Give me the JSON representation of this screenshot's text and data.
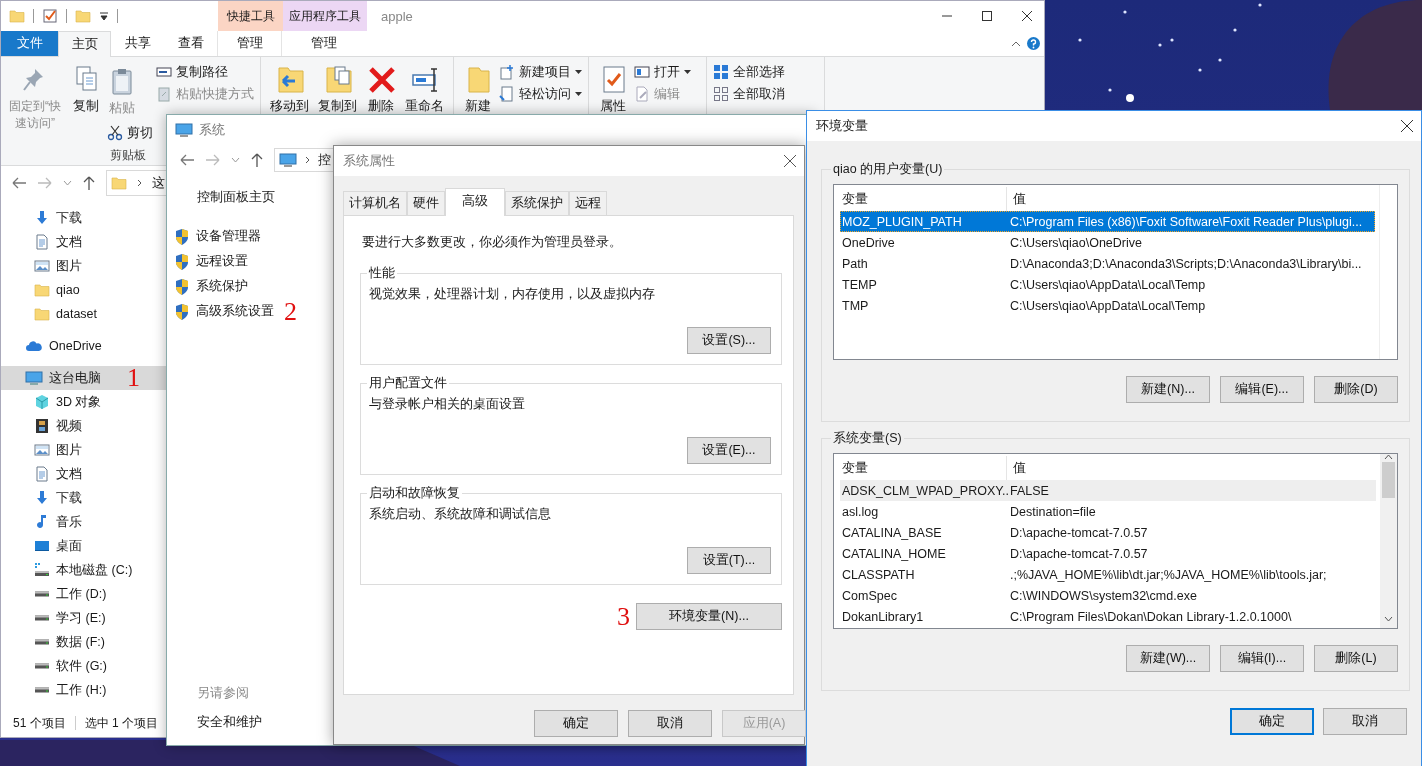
{
  "explorer": {
    "title": "apple",
    "context_tabs": [
      {
        "label": "快捷工具",
        "color": "#fbd5c4"
      },
      {
        "label": "应用程序工具",
        "color": "#ecd7f4"
      }
    ],
    "ribbon_tabs": [
      {
        "label": "文件",
        "kind": "file",
        "selected": false
      },
      {
        "label": "主页",
        "kind": "normal",
        "selected": true
      },
      {
        "label": "共享",
        "kind": "normal",
        "selected": false
      },
      {
        "label": "查看",
        "kind": "normal",
        "selected": false
      },
      {
        "label": "管理",
        "kind": "context",
        "selected": false
      },
      {
        "label": "管理",
        "kind": "context",
        "selected": false
      }
    ],
    "ribbon_groups": [
      {
        "label": "剪贴板",
        "items": [
          {
            "kind": "large",
            "label": "固定到“快速访问”",
            "disabled": true
          },
          {
            "kind": "large",
            "label": "复制",
            "disabled": false
          },
          {
            "kind": "stack",
            "items": [
              {
                "kind": "large",
                "label": "粘贴",
                "disabled": true,
                "dropdown": false
              },
              {
                "kind": "small",
                "label": "剪切",
                "disabled": false,
                "dropdown": false
              }
            ]
          },
          {
            "kind": "stack",
            "items": [
              {
                "kind": "small",
                "label": "复制路径",
                "disabled": false,
                "dropdown": false
              },
              {
                "kind": "small",
                "label": "粘贴快捷方式",
                "disabled": true,
                "dropdown": false
              }
            ]
          }
        ]
      },
      {
        "items": [
          {
            "kind": "large",
            "label": "移动到",
            "disabled": false
          },
          {
            "kind": "large",
            "label": "复制到",
            "disabled": false
          },
          {
            "kind": "large",
            "label": "删除",
            "disabled": false
          },
          {
            "kind": "large",
            "label": "重命名",
            "disabled": false
          }
        ]
      },
      {
        "items": [
          {
            "kind": "large",
            "label": "新建",
            "disabled": false
          },
          {
            "kind": "stack",
            "items": [
              {
                "kind": "small",
                "label": "新建项目",
                "disabled": false,
                "dropdown": true
              },
              {
                "kind": "small",
                "label": "轻松访问",
                "disabled": false,
                "dropdown": true
              }
            ]
          }
        ]
      },
      {
        "items": [
          {
            "kind": "large",
            "label": "属性",
            "disabled": false
          },
          {
            "kind": "stack",
            "items": [
              {
                "kind": "small",
                "label": "打开",
                "disabled": false,
                "dropdown": true
              },
              {
                "kind": "small",
                "label": "编辑",
                "disabled": true,
                "dropdown": false
              }
            ]
          }
        ]
      },
      {
        "items": [
          {
            "kind": "stack",
            "items": [
              {
                "kind": "small",
                "label": "全部选择",
                "disabled": false,
                "dropdown": false
              },
              {
                "kind": "small",
                "label": "全部取消",
                "disabled": false,
                "dropdown": false
              }
            ]
          }
        ]
      }
    ],
    "address": "这",
    "quick_access": [
      {
        "label": "下载",
        "kind": "download",
        "selected": false
      },
      {
        "label": "文档",
        "kind": "document",
        "selected": false
      },
      {
        "label": "图片",
        "kind": "picture",
        "selected": false
      },
      {
        "label": "qiao",
        "kind": "folder",
        "selected": false
      },
      {
        "label": "dataset",
        "kind": "folder",
        "selected": false
      }
    ],
    "nav": [
      {
        "label": "OneDrive",
        "kind": "cloud",
        "selected": false
      },
      {
        "label": "这台电脑",
        "kind": "computer",
        "selected": true,
        "annotation": "1",
        "children": [
          {
            "label": "3D 对象",
            "kind": "object3d",
            "selected": false
          },
          {
            "label": "视频",
            "kind": "video",
            "selected": false
          },
          {
            "label": "图片",
            "kind": "picture",
            "selected": false
          },
          {
            "label": "文档",
            "kind": "document",
            "selected": false
          },
          {
            "label": "下载",
            "kind": "download",
            "selected": false
          },
          {
            "label": "音乐",
            "kind": "music",
            "selected": false
          },
          {
            "label": "桌面",
            "kind": "desktop",
            "selected": false
          },
          {
            "label": "本地磁盘 (C:)",
            "kind": "system-drive",
            "selected": false
          },
          {
            "label": "工作 (D:)",
            "kind": "drive",
            "selected": false
          },
          {
            "label": "学习 (E:)",
            "kind": "drive",
            "selected": false
          },
          {
            "label": "数据 (F:)",
            "kind": "drive",
            "selected": false
          },
          {
            "label": "软件 (G:)",
            "kind": "drive",
            "selected": false
          },
          {
            "label": "工作 (H:)",
            "kind": "drive",
            "selected": false
          }
        ]
      }
    ],
    "status": [
      "51 个项目",
      "选中 1 个项目"
    ]
  },
  "system": {
    "title": "系统",
    "address": "控",
    "home_link": "控制面板主页",
    "links": [
      {
        "label": "设备管理器"
      },
      {
        "label": "远程设置"
      },
      {
        "label": "系统保护"
      },
      {
        "label": "高级系统设置",
        "annotation": "2"
      }
    ],
    "see_also_title": "另请参阅",
    "see_also": [
      "安全和维护"
    ]
  },
  "system_properties": {
    "title": "系统属性",
    "tabs": [
      {
        "label": "计算机名",
        "selected": false
      },
      {
        "label": "硬件",
        "selected": false
      },
      {
        "label": "高级",
        "selected": true
      },
      {
        "label": "系统保护",
        "selected": false
      },
      {
        "label": "远程",
        "selected": false
      }
    ],
    "admin_note": "要进行大多数更改，你必须作为管理员登录。",
    "groups": [
      {
        "title": "性能",
        "description": "视觉效果，处理器计划，内存使用，以及虚拟内存",
        "button": "设置(S)..."
      },
      {
        "title": "用户配置文件",
        "description": "与登录帐户相关的桌面设置",
        "button": "设置(E)..."
      },
      {
        "title": "启动和故障恢复",
        "description": "系统启动、系统故障和调试信息",
        "button": "设置(T)..."
      }
    ],
    "env_annotation": "3",
    "env_button": "环境变量(N)...",
    "buttons": [
      {
        "label": "确定",
        "disabled": false
      },
      {
        "label": "取消",
        "disabled": false
      },
      {
        "label": "应用(A)",
        "disabled": true
      }
    ]
  },
  "environment_variables": {
    "title": "环境变量",
    "user_group": {
      "title": "qiao 的用户变量(U)",
      "focused": true,
      "columns": [
        "变量",
        "值"
      ],
      "rows": [
        {
          "name": "MOZ_PLUGIN_PATH",
          "value": "C:\\Program Files (x86)\\Foxit Software\\Foxit Reader Plus\\plugi...",
          "selected": true
        },
        {
          "name": "OneDrive",
          "value": "C:\\Users\\qiao\\OneDrive",
          "selected": false
        },
        {
          "name": "Path",
          "value": "D:\\Anaconda3;D:\\Anaconda3\\Scripts;D:\\Anaconda3\\Library\\bi...",
          "selected": false
        },
        {
          "name": "TEMP",
          "value": "C:\\Users\\qiao\\AppData\\Local\\Temp",
          "selected": false
        },
        {
          "name": "TMP",
          "value": "C:\\Users\\qiao\\AppData\\Local\\Temp",
          "selected": false
        }
      ],
      "buttons": [
        "新建(N)...",
        "编辑(E)...",
        "删除(D)"
      ]
    },
    "system_group": {
      "title": "系统变量(S)",
      "focused": false,
      "columns": [
        "变量",
        "值"
      ],
      "rows": [
        {
          "name": "ADSK_CLM_WPAD_PROXY...",
          "value": "FALSE",
          "selected": true
        },
        {
          "name": "asl.log",
          "value": "Destination=file",
          "selected": false
        },
        {
          "name": "CATALINA_BASE",
          "value": "D:\\apache-tomcat-7.0.57",
          "selected": false
        },
        {
          "name": "CATALINA_HOME",
          "value": "D:\\apache-tomcat-7.0.57",
          "selected": false
        },
        {
          "name": "CLASSPATH",
          "value": ".;%JAVA_HOME%\\lib\\dt.jar;%JAVA_HOME%\\lib\\tools.jar;",
          "selected": false
        },
        {
          "name": "ComSpec",
          "value": "C:\\WINDOWS\\system32\\cmd.exe",
          "selected": false
        },
        {
          "name": "DokanLibrary1",
          "value": "C:\\Program Files\\Dokan\\Dokan Library-1.2.0.1000\\",
          "selected": false
        }
      ],
      "buttons": [
        "新建(W)...",
        "编辑(I)...",
        "删除(L)"
      ]
    },
    "buttons": [
      {
        "label": "确定",
        "default": true
      },
      {
        "label": "取消",
        "default": false
      }
    ]
  }
}
